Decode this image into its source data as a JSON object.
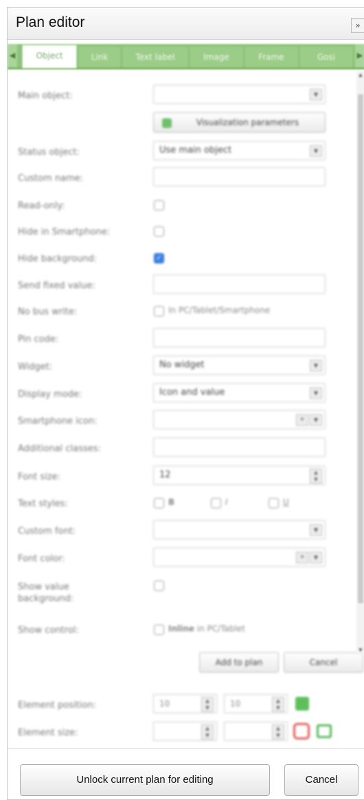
{
  "window": {
    "title": "Plan editor",
    "collapse_icon": "»",
    "collapse_icon_name": "double-chevron-right-icon"
  },
  "tabs": {
    "left_arrow": "◀",
    "right_arrow": "▶",
    "items": [
      {
        "label": "Object",
        "active": true
      },
      {
        "label": "Link",
        "active": false
      },
      {
        "label": "Text label",
        "active": false
      },
      {
        "label": "Image",
        "active": false
      },
      {
        "label": "Frame",
        "active": false
      },
      {
        "label": "Gosi",
        "active": false
      }
    ]
  },
  "form": {
    "main_object": {
      "label": "Main object:",
      "value": ""
    },
    "visualization_button": "Visualization parameters",
    "status_object": {
      "label": "Status object:",
      "value": "Use main object"
    },
    "custom_name": {
      "label": "Custom name:",
      "value": ""
    },
    "read_only": {
      "label": "Read-only:",
      "checked": false
    },
    "hide_smartphone": {
      "label": "Hide in Smartphone:",
      "checked": false
    },
    "hide_background": {
      "label": "Hide background:",
      "checked": true
    },
    "send_fixed_value": {
      "label": "Send fixed value:",
      "value": ""
    },
    "no_bus_write": {
      "label": "No bus write:",
      "checked": false,
      "text": "In PC/Tablet/Smartphone"
    },
    "pin_code": {
      "label": "Pin code:",
      "value": ""
    },
    "widget": {
      "label": "Widget:",
      "value": "No widget"
    },
    "display_mode": {
      "label": "Display mode:",
      "value": "Icon and value"
    },
    "smartphone_icon": {
      "label": "Smartphone icon:",
      "value": ""
    },
    "additional_classes": {
      "label": "Additional classes:",
      "value": ""
    },
    "font_size": {
      "label": "Font size:",
      "value": "12"
    },
    "text_styles": {
      "label": "Text styles:",
      "bold": "B",
      "italic": "I",
      "underline": "U"
    },
    "custom_font": {
      "label": "Custom font:",
      "value": ""
    },
    "font_color": {
      "label": "Font color:",
      "value": ""
    },
    "show_value_background": {
      "label_line1": "Show value",
      "label_line2": "background:",
      "checked": false
    },
    "show_control": {
      "label": "Show control:",
      "inline_text": "Inline",
      "suffix": "in PC/Tablet",
      "checked": false
    },
    "add_to_plan": "Add to plan",
    "cancel": "Cancel",
    "element_position": {
      "label": "Element position:",
      "x": "10",
      "y": "10"
    },
    "element_size": {
      "label": "Element size:",
      "w": "",
      "h": ""
    }
  },
  "footer": {
    "unlock_button": "Unlock current plan for editing",
    "cancel_button": "Cancel"
  },
  "colors": {
    "tab_green": "#9ccd88",
    "checkbox_blue": "#3a82e0",
    "position_icon": "#5cbf5c",
    "size_icon": "#e05a5a",
    "lock_icon": "#55b555"
  }
}
